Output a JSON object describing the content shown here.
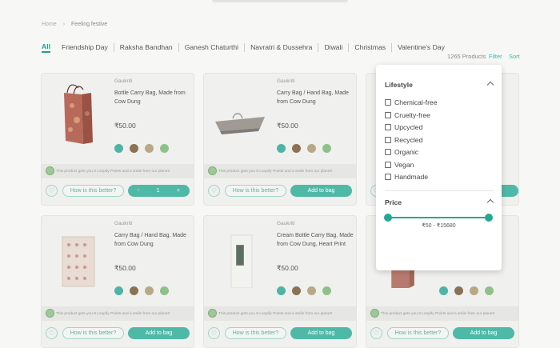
{
  "breadcrumb": {
    "home": "Home",
    "sep": "›",
    "current": "Feeling festive"
  },
  "tabs": [
    "All",
    "Friendship Day",
    "Raksha Bandhan",
    "Ganesh Chaturthi",
    "Navratri & Dussehra",
    "Diwali",
    "Christmas",
    "Valentine's Day"
  ],
  "toolbar": {
    "count": "1265 Products",
    "filter": "Filter",
    "sort": "Sort"
  },
  "cards": [
    {
      "brand": "Gaukriti",
      "title": "Bottle Carry Bag, Made from Cow Dung",
      "price": "₹50.00",
      "points": "This product gets you 8 Loopify Points and a smile from our planet!",
      "better": "How is this better?",
      "stepper": {
        "minus": "-",
        "qty": "1",
        "plus": "+"
      }
    },
    {
      "brand": "Gaukriti",
      "title": "Carry Bag / Hand Bag, Made from Cow Dung",
      "price": "₹50.00",
      "points": "This product gets you 8 Loopify Points and a smile from our planet!",
      "better": "How is this better?",
      "add": "Add to bag"
    },
    {
      "brand": "Gaukriti",
      "title": "Carry Bag / Hand Bag, Made from Cow Dung",
      "price": "₹50.00",
      "points": "This product gets you 8 Loopify Points and a smile from our planet!",
      "better": "How is this better?",
      "add": "Add to bag"
    },
    {
      "brand": "Gaukriti",
      "title": "Cream Bottle Carry Bag, Made from Cow Dung, Heart Print",
      "price": "₹50.00",
      "points": "This product gets you 8 Loopify Points and a smile from our planet!",
      "better": "How is this better?",
      "add": "Add to bag"
    },
    {
      "points": "This product gets you 8 Loopify Points and a smile from our planet!",
      "better": "How is this better?",
      "add": "Add to bag"
    }
  ],
  "filter_panel": {
    "lifestyle_title": "Lifestyle",
    "options": [
      "Chemical-free",
      "Cruelty-free",
      "Upcycled",
      "Recycled",
      "Organic",
      "Vegan",
      "Handmade"
    ],
    "price_title": "Price",
    "price_range": "₹50 - ₹15680"
  },
  "icons": {
    "heart": "heart-icon",
    "globe": "globe-icon",
    "chevron": "chevron-up-icon"
  },
  "colors": {
    "accent": "#4fb9a7",
    "slider": "#24a892"
  }
}
